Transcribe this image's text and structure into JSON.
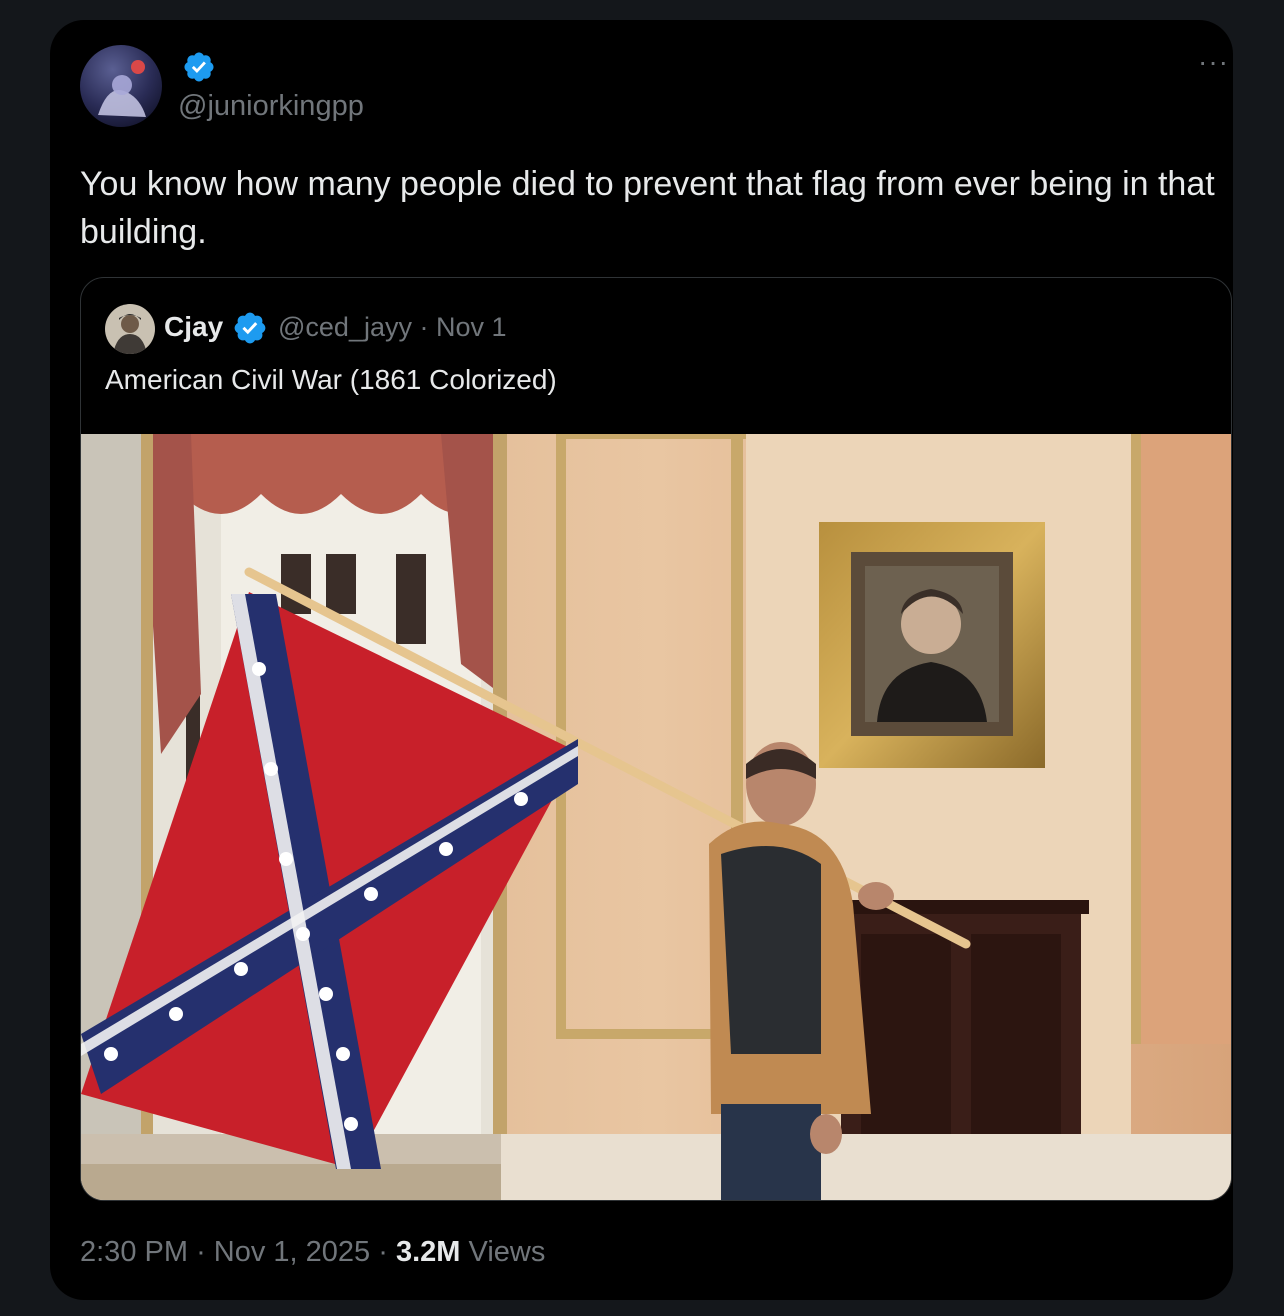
{
  "tweet": {
    "handle": "@juniorkingpp",
    "text": "You know how many people died to prevent that flag from ever being in that building.",
    "more_icon": "more-icon"
  },
  "quoted_tweet": {
    "name": "Cjay",
    "handle": "@ced_jayy",
    "separator": "·",
    "date": "Nov 1",
    "text": "American Civil War (1861 Colorized)"
  },
  "footer": {
    "time": "2:30 PM",
    "sep1": "·",
    "date": "Nov 1, 2025",
    "sep2": "·",
    "views_count": "3.2M",
    "views_label": "Views"
  },
  "colors": {
    "background": "#000000",
    "text_primary": "#e7e9ea",
    "text_secondary": "#71767b",
    "verified": "#1d9bf0",
    "border": "#2f3336"
  }
}
